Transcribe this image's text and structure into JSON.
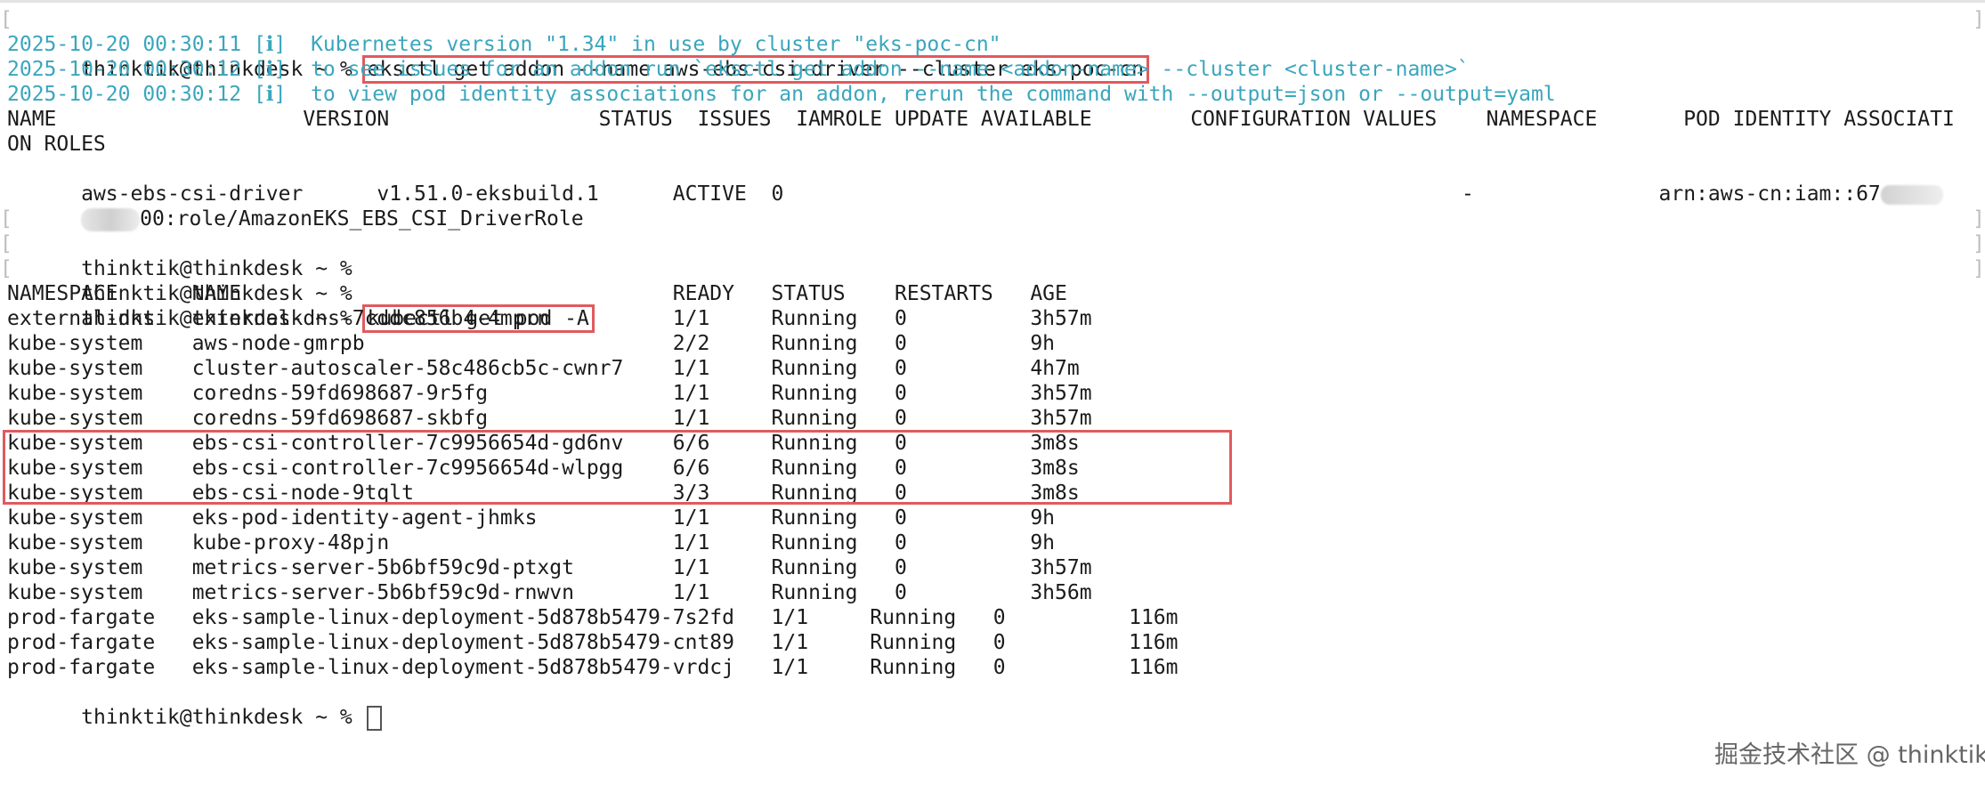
{
  "terminal": {
    "lines": [
      {
        "prompt": "thinktik@thinkdesk ~ % ",
        "command": "eksctl get addon --name aws-ebs-csi-driver --cluster eks-poc-cn"
      },
      {
        "text": "2025-10-20 00:30:11 [ℹ]  Kubernetes version \"1.34\" in use by cluster \"eks-poc-cn\""
      },
      {
        "text": "2025-10-20 00:30:12 [ℹ]  to see issues for an addon run `eksctl get addon --name <addon-name> --cluster <cluster-name>`"
      },
      {
        "text": "2025-10-20 00:30:12 [ℹ]  to view pod identity associations for an addon, rerun the command with --output=json or --output=yaml"
      },
      {
        "text": "NAME                    VERSION                 STATUS  ISSUES  IAMROLE UPDATE AVAILABLE        CONFIGURATION VALUES    NAMESPACE       POD IDENTITY ASSOCIATI"
      },
      {
        "text": "ON ROLES"
      },
      {
        "text": "aws-ebs-csi-driver      v1.51.0-eksbuild.1      ACTIVE  0                                                       -               arn:aws-cn:iam::67"
      },
      {
        "text": "00:role/AmazonEKS_EBS_CSI_DriverRole"
      },
      {
        "text": "thinktik@thinkdesk ~ % "
      },
      {
        "text": "thinktik@thinkdesk ~ % "
      },
      {
        "prompt": "thinktik@thinkdesk ~ % ",
        "command": "kubectl get pod -A"
      },
      {
        "text": "NAMESPACE      NAME                                   READY   STATUS    RESTARTS   AGE"
      },
      {
        "text": "external-dns   external-dns-7cddc856b4-4mprn          1/1     Running   0          3h57m"
      },
      {
        "text": "kube-system    aws-node-gmrpb                         2/2     Running   0          9h"
      },
      {
        "text": "kube-system    cluster-autoscaler-58c486cb5c-cwnr7    1/1     Running   0          4h7m"
      },
      {
        "text": "kube-system    coredns-59fd698687-9r5fg               1/1     Running   0          3h57m"
      },
      {
        "text": "kube-system    coredns-59fd698687-skbfg               1/1     Running   0          3h57m"
      },
      {
        "text": "kube-system    ebs-csi-controller-7c9956654d-gd6nv    6/6     Running   0          3m8s"
      },
      {
        "text": "kube-system    ebs-csi-controller-7c9956654d-wlpgg    6/6     Running   0          3m8s"
      },
      {
        "text": "kube-system    ebs-csi-node-9tqlt                     3/3     Running   0          3m8s"
      },
      {
        "text": "kube-system    eks-pod-identity-agent-jhmks           1/1     Running   0          9h"
      },
      {
        "text": "kube-system    kube-proxy-48pjn                       1/1     Running   0          9h"
      },
      {
        "text": "kube-system    metrics-server-5b6bf59c9d-ptxgt        1/1     Running   0          3h57m"
      },
      {
        "text": "kube-system    metrics-server-5b6bf59c9d-rnwvn        1/1     Running   0          3h56m"
      },
      {
        "text": "prod-fargate   eks-sample-linux-deployment-5d878b5479-7s2fd   1/1     Running   0          116m"
      },
      {
        "text": "prod-fargate   eks-sample-linux-deployment-5d878b5479-cnt89   1/1     Running   0          116m"
      },
      {
        "text": "prod-fargate   eks-sample-linux-deployment-5d878b5479-vrdcj   1/1     Running   0          116m"
      },
      {
        "text": "thinktik@thinkdesk ~ % "
      }
    ]
  },
  "watermark": "掘金技术社区 @ thinktik",
  "colors": {
    "info": "#3aa6bd",
    "highlight": "#e05a5f",
    "text": "#1b1b1b"
  },
  "icons": {
    "cursor": "block-cursor-icon"
  }
}
